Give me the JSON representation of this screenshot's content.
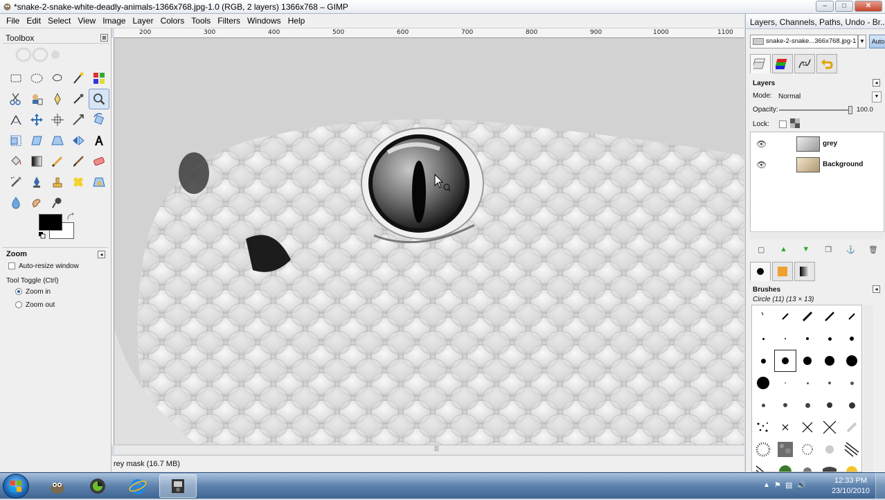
{
  "window": {
    "title": "*snake-2-snake-white-deadly-animals-1366x768.jpg-1.0 (RGB, 2 layers) 1366x768 – GIMP",
    "controls": {
      "minimize": "–",
      "maximize": "□",
      "close": "✕"
    }
  },
  "menu": [
    "File",
    "Edit",
    "Select",
    "View",
    "Image",
    "Layer",
    "Colors",
    "Tools",
    "Filters",
    "Windows",
    "Help"
  ],
  "ruler": {
    "labels": [
      "200",
      "300",
      "400",
      "500",
      "600",
      "700",
      "800",
      "900",
      "1000",
      "1100"
    ]
  },
  "toolbox": {
    "title": "Toolbox",
    "close": "⊠",
    "tools": [
      "rect-select-icon",
      "ellipse-select-icon",
      "free-select-icon",
      "fuzzy-select-icon",
      "select-by-color-icon",
      "scissors-icon",
      "foreground-select-icon",
      "paths-icon",
      "color-picker-icon",
      "zoom-icon",
      "measure-icon",
      "move-icon",
      "align-icon",
      "crop-icon",
      "rotate-icon",
      "scale-icon",
      "shear-icon",
      "perspective-icon",
      "flip-icon",
      "text-icon",
      "bucket-fill-icon",
      "blend-icon",
      "pencil-icon",
      "paintbrush-icon",
      "eraser-icon",
      "airbrush-icon",
      "ink-icon",
      "clone-icon",
      "heal-icon",
      "perspective-clone-icon",
      "blur-icon",
      "smudge-icon",
      "dodge-burn-icon"
    ],
    "active_tool": "zoom-icon",
    "colors": {
      "foreground": "#000000",
      "background": "#ffffff"
    }
  },
  "tool_options": {
    "title": "Zoom",
    "auto_resize": "Auto-resize window",
    "toggle_label": "Tool Toggle  (Ctrl)",
    "zoom_in": "Zoom in",
    "zoom_out": "Zoom out",
    "selected": "zoom_in"
  },
  "status": {
    "text": "rey mask (16.7 MB)"
  },
  "dock": {
    "title": "Layers, Channels, Paths, Undo - Br...",
    "image_select": "snake-2-snake...366x768.jpg-1",
    "auto_label": "Auto",
    "tabs": [
      "layers-tab-icon",
      "channels-tab-icon",
      "paths-tab-icon",
      "undo-tab-icon"
    ],
    "layers": {
      "header": "Layers",
      "mode_label": "Mode:",
      "mode_value": "Normal",
      "opacity_label": "Opacity:",
      "opacity_value": "100.0",
      "lock_label": "Lock:",
      "items": [
        {
          "name": "grey",
          "visible": true
        },
        {
          "name": "Background",
          "visible": true
        }
      ]
    },
    "brushes": {
      "header": "Brushes",
      "current": "Circle (11) (13 × 13)"
    }
  },
  "taskbar": {
    "apps": [
      "gimp-wilber-icon",
      "gimp-shortcut-icon",
      "internet-explorer-icon",
      "gimp-image-window-icon"
    ],
    "time": "12:33 PM",
    "date": "23/10/2010"
  }
}
